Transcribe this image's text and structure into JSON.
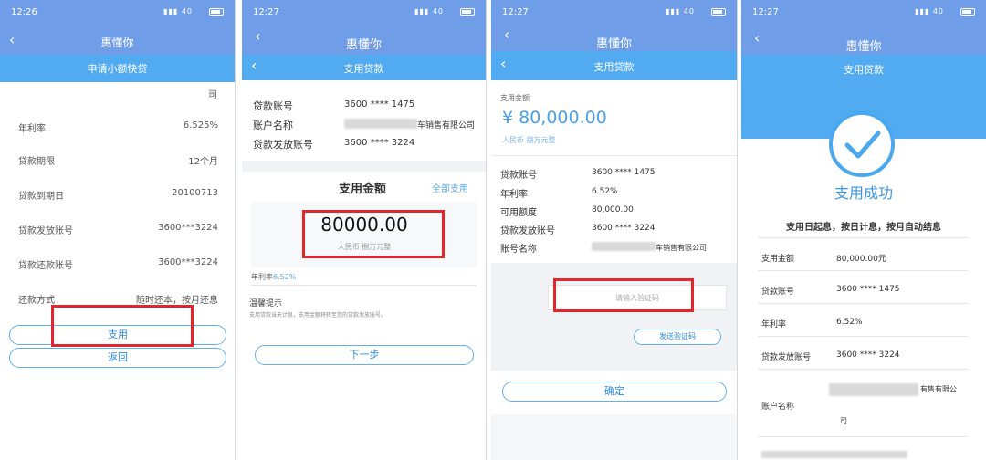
{
  "p1": {
    "time": "12:26",
    "signal": "40",
    "title": "惠懂你",
    "subtitle": "申请小额快贷",
    "top_text": "司",
    "rows": [
      {
        "label": "年利率",
        "value": "6.525%"
      },
      {
        "label": "贷款期限",
        "value": "12个月"
      },
      {
        "label": "贷款到期日",
        "value": "20100713"
      },
      {
        "label": "贷款发放账号",
        "value": "3600***3224"
      },
      {
        "label": "贷款还款账号",
        "value": "3600***3224"
      },
      {
        "label": "还款方式",
        "value": "随时还本，按月还息"
      }
    ],
    "btn_use": "支用",
    "btn_back": "返回"
  },
  "p2": {
    "time": "12:27",
    "signal": "40",
    "title": "惠懂你",
    "subtitle": "支用贷款",
    "info": [
      {
        "label": "贷款账号",
        "value": "3600 **** 1475"
      },
      {
        "label": "账户名称",
        "value": "车销售有限公司"
      },
      {
        "label": "贷款发放账号",
        "value": "3600 **** 3224"
      }
    ],
    "amount_title": "支用金额",
    "all_use": "全部支用",
    "amount": "80000.00",
    "amount_sub": "人民币 捌万元整",
    "rate_label": "年利率",
    "rate_value": "6.52%",
    "tip_title": "温馨提示",
    "tip_text": "支用贷款当天计息，支用金额将转至您的贷款发放账号。",
    "next": "下一步"
  },
  "p3": {
    "time": "12:27",
    "signal": "40",
    "title": "惠懂你",
    "subtitle": "支用贷款",
    "amount_label": "支用金额",
    "amount": "¥ 80,000.00",
    "amount_sub": "人民币  捌万元整",
    "rows": [
      {
        "label": "贷款账号",
        "value": "3600 **** 1475"
      },
      {
        "label": "年利率",
        "value": "6.52%"
      },
      {
        "label": "可用额度",
        "value": "80,000.00"
      },
      {
        "label": "贷款发放账号",
        "value": "3600 **** 3224"
      },
      {
        "label": "账号名称",
        "value": "车销售有限公司"
      }
    ],
    "code_placeholder": "请输入验证码",
    "send_code": "发送验证码",
    "confirm": "确定"
  },
  "p4": {
    "time": "12:27",
    "signal": "40",
    "title": "惠懂你",
    "subtitle": "支用贷款",
    "success": "支用成功",
    "flow": "支用日起息，按日计息，按月自动结息",
    "rows": [
      {
        "label": "支用金额",
        "value": "80,000.00元"
      },
      {
        "label": "贷款账号",
        "value": "3600 **** 1475"
      },
      {
        "label": "年利率",
        "value": "6.52%"
      },
      {
        "label": "贷款发放账号",
        "value": "3600 **** 3224"
      }
    ],
    "account_label": "账户名称",
    "account_value": "有售有限公",
    "account_value2": "司"
  },
  "colors": {
    "header_blue": "#6f9de8",
    "bar_blue": "#52aaf0",
    "red": "#e3262b",
    "link": "#2f8bdc"
  }
}
